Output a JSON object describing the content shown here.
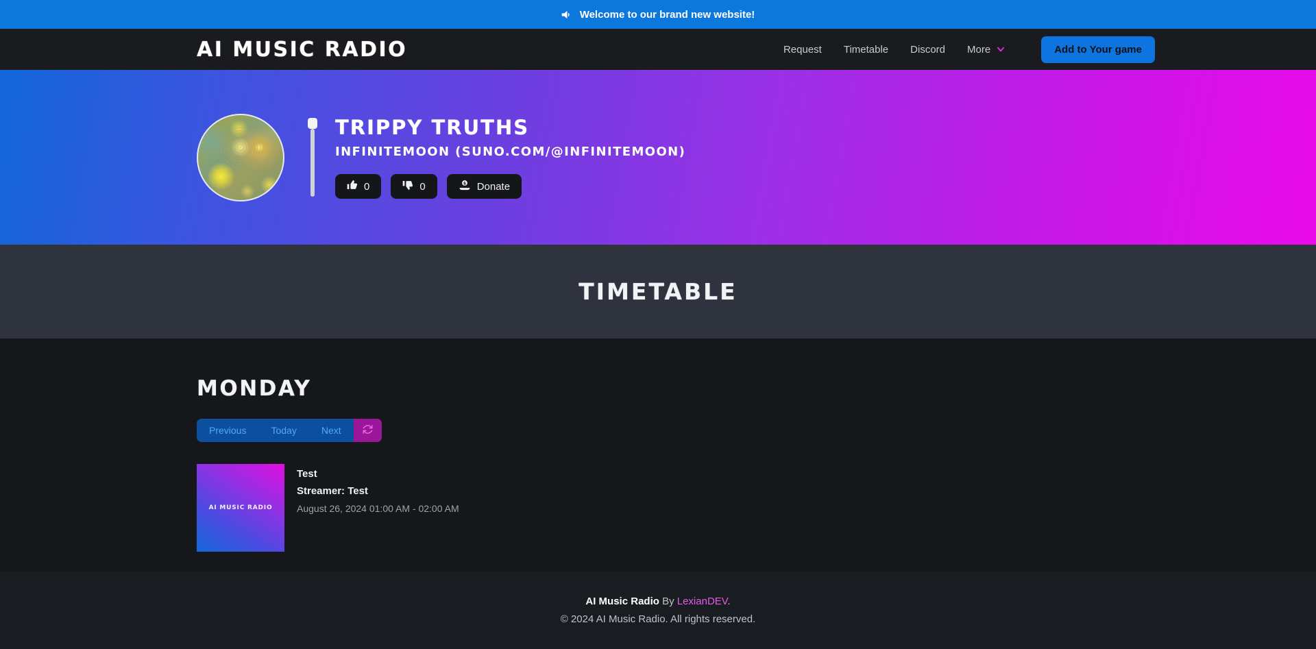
{
  "announcement": {
    "icon": "megaphone-icon",
    "text": "Welcome to our brand new website!",
    "background": "#0c78dc"
  },
  "navbar": {
    "brand": "AI MUSIC RADIO",
    "links": [
      {
        "label": "Request"
      },
      {
        "label": "Timetable"
      },
      {
        "label": "Discord"
      }
    ],
    "more": {
      "label": "More",
      "icon": "chevron-down-icon",
      "icon_color": "#dd2ddd"
    },
    "cta": {
      "label": "Add to Your game",
      "background": "#0d74e0"
    }
  },
  "hero": {
    "album_art_alt": "circular-psychedelic-album-art",
    "volume_slider": {
      "icon": "vertical-volume-slider",
      "value": 100
    },
    "track_title": "TRIPPY TRUTHS",
    "track_artist": "INFINITEMOON (SUNO.COM/@INFINITEMOON)",
    "actions": [
      {
        "name": "like",
        "icon": "thumbs-up-icon",
        "count": "0"
      },
      {
        "name": "dislike",
        "icon": "thumbs-down-icon",
        "count": "0"
      },
      {
        "name": "donate",
        "icon": "hand-holding-dollar-icon",
        "label": "Donate"
      }
    ],
    "gradient_from": "#1166d8",
    "gradient_to": "#ea0aea"
  },
  "timetable_band": {
    "title": "TIMETABLE",
    "background": "#2f333d"
  },
  "timetable": {
    "day_heading": "MONDAY",
    "controls": [
      {
        "label": "Previous",
        "name": "previous-button"
      },
      {
        "label": "Today",
        "name": "today-button"
      },
      {
        "label": "Next",
        "name": "next-button"
      }
    ],
    "refresh": {
      "icon": "refresh-icon",
      "background": "#9a179a",
      "icon_color": "#ef6ae8"
    },
    "entries": [
      {
        "thumbnail_label": "AI MUSIC RADIO",
        "title": "Test",
        "streamer": "Streamer: Test",
        "time": "August 26, 2024 01:00 AM - 02:00 AM"
      }
    ]
  },
  "footer": {
    "brand": "AI Music Radio",
    "by": " By ",
    "developer": "LexianDEV",
    "period": ".",
    "copyright": "© 2024 AI Music Radio. All rights reserved."
  }
}
